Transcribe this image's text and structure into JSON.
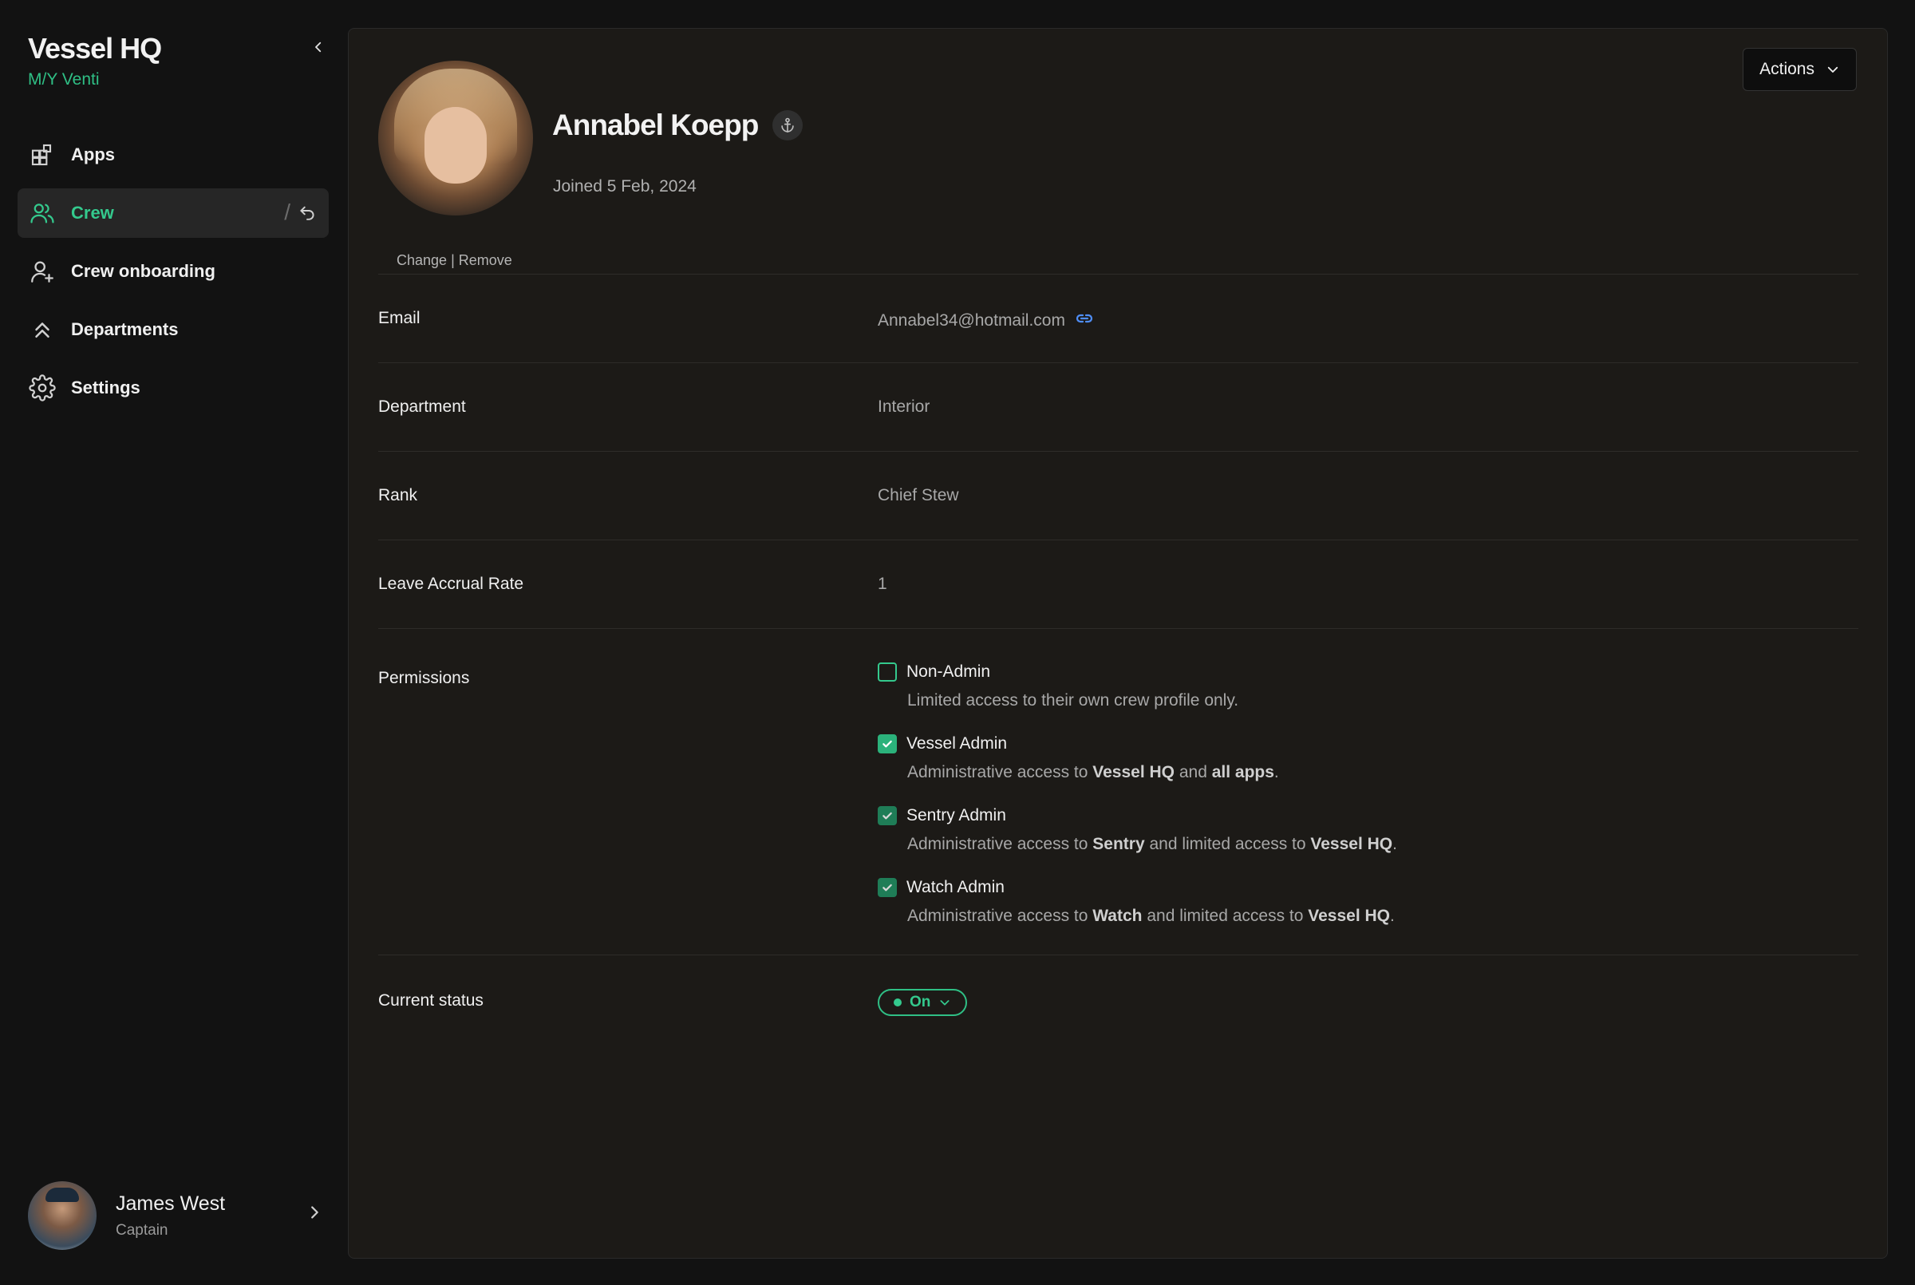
{
  "brand": {
    "title": "Vessel HQ",
    "vessel": "M/Y Venti"
  },
  "nav": {
    "apps": "Apps",
    "crew": "Crew",
    "crew_onboarding": "Crew onboarding",
    "departments": "Departments",
    "settings": "Settings",
    "separator": "/"
  },
  "current_user": {
    "name": "James West",
    "role": "Captain"
  },
  "actions": {
    "label": "Actions"
  },
  "profile": {
    "name": "Annabel Koepp",
    "joined": "Joined 5 Feb, 2024",
    "change": "Change",
    "divider": "|",
    "remove": "Remove"
  },
  "fields": {
    "email_label": "Email",
    "email_value": "Annabel34@hotmail.com",
    "department_label": "Department",
    "department_value": "Interior",
    "rank_label": "Rank",
    "rank_value": "Chief Stew",
    "leave_label": "Leave Accrual Rate",
    "leave_value": "1",
    "permissions_label": "Permissions",
    "status_label": "Current status",
    "status_value": "On"
  },
  "permissions": [
    {
      "title": "Non-Admin",
      "checked": false,
      "desc": [
        {
          "t": "Limited access to their own crew profile only."
        }
      ]
    },
    {
      "title": "Vessel Admin",
      "checked": true,
      "desc": [
        {
          "t": "Administrative access to "
        },
        {
          "t": "Vessel HQ",
          "b": true
        },
        {
          "t": " and "
        },
        {
          "t": "all apps",
          "b": true
        },
        {
          "t": "."
        }
      ]
    },
    {
      "title": "Sentry Admin",
      "checked": true,
      "desc": [
        {
          "t": "Administrative access to "
        },
        {
          "t": "Sentry",
          "b": true
        },
        {
          "t": " and limited access to "
        },
        {
          "t": "Vessel HQ",
          "b": true
        },
        {
          "t": "."
        }
      ]
    },
    {
      "title": "Watch Admin",
      "checked": true,
      "desc": [
        {
          "t": "Administrative access to "
        },
        {
          "t": "Watch",
          "b": true
        },
        {
          "t": " and limited access to "
        },
        {
          "t": "Vessel HQ",
          "b": true
        },
        {
          "t": "."
        }
      ]
    }
  ],
  "colors": {
    "accent": "#34c98d",
    "background": "#121212",
    "panel": "#1c1a17"
  }
}
